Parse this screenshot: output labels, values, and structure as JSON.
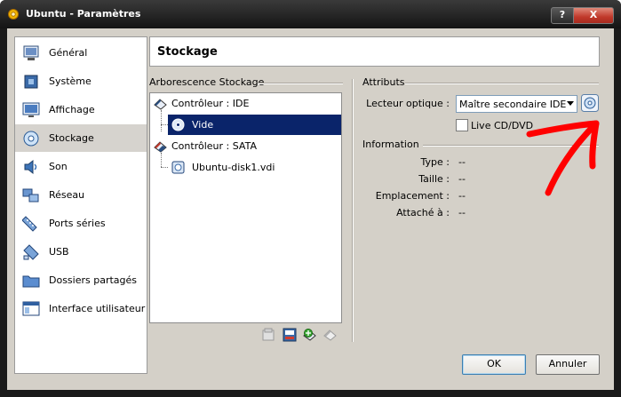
{
  "window": {
    "title": "Ubuntu - Paramètres",
    "help_label": "?",
    "close_label": "X"
  },
  "sidebar": {
    "items": [
      {
        "label": "Général",
        "icon": "monitor-icon"
      },
      {
        "label": "Système",
        "icon": "chip-icon"
      },
      {
        "label": "Affichage",
        "icon": "display-icon"
      },
      {
        "label": "Stockage",
        "icon": "disk-icon",
        "selected": true
      },
      {
        "label": "Son",
        "icon": "speaker-icon"
      },
      {
        "label": "Réseau",
        "icon": "network-icon"
      },
      {
        "label": "Ports séries",
        "icon": "serial-port-icon"
      },
      {
        "label": "USB",
        "icon": "usb-icon"
      },
      {
        "label": "Dossiers partagés",
        "icon": "folder-icon"
      },
      {
        "label": "Interface utilisateur",
        "icon": "window-icon"
      }
    ]
  },
  "header": {
    "title": "Stockage"
  },
  "storage_tree": {
    "title": "Arborescence Stockage",
    "controllers": [
      {
        "label": "Contrôleur : IDE",
        "children": [
          {
            "label": "Vide",
            "selected": true
          }
        ]
      },
      {
        "label": "Contrôleur : SATA",
        "children": [
          {
            "label": "Ubuntu-disk1.vdi"
          }
        ]
      }
    ]
  },
  "attributes": {
    "title": "Attributs",
    "optical_drive_label": "Lecteur optique :",
    "optical_drive_value": "Maître secondaire IDE",
    "live_cd_label": "Live CD/DVD",
    "live_cd_checked": false
  },
  "information": {
    "title": "Information",
    "rows": [
      {
        "label": "Type :",
        "value": "--"
      },
      {
        "label": "Taille :",
        "value": "--"
      },
      {
        "label": "Emplacement :",
        "value": "--"
      },
      {
        "label": "Attaché à :",
        "value": "--"
      }
    ]
  },
  "buttons": {
    "ok": "OK",
    "cancel": "Annuler"
  },
  "colors": {
    "selection": "#0a246a",
    "annotation": "#ff0000"
  }
}
